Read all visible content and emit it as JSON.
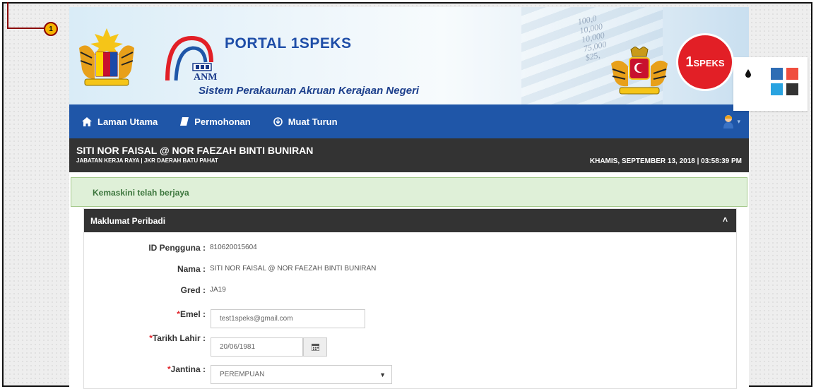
{
  "callout": {
    "number": "1"
  },
  "header": {
    "title": "PORTAL 1SPEKS",
    "subtitle": "Sistem Perakaunan Akruan Kerajaan Negeri",
    "anm_label": "ANM",
    "brand_logo": {
      "prefix": "1",
      "text": "SPEKS"
    },
    "numbers_deco": [
      "100,0",
      "10,000",
      "10,000",
      "75,000",
      "$25,"
    ]
  },
  "navbar": {
    "items": [
      {
        "label": "Laman Utama",
        "icon": "home-icon"
      },
      {
        "label": "Permohonan",
        "icon": "book-icon"
      },
      {
        "label": "Muat Turun",
        "icon": "download-circle-icon"
      }
    ],
    "avatar_icon": "user-avatar-icon",
    "caret": "▾"
  },
  "user": {
    "name": "SITI NOR FAISAL @ NOR FAEZAH BINTI BUNIRAN",
    "department": "JABATAN KERJA RAYA | JKR DAERAH BATU PAHAT",
    "datetime": "KHAMIS, SEPTEMBER 13, 2018 | 03:58:39 PM"
  },
  "alert": {
    "message": "Kemaskini telah berjaya"
  },
  "panel": {
    "title": "Maklumat Peribadi",
    "toggle": "˄",
    "fields": {
      "id": {
        "label": "ID Pengguna",
        "value": "810620015604"
      },
      "nama": {
        "label": "Nama",
        "value": "SITI NOR FAISAL @ NOR FAEZAH BINTI BUNIRAN"
      },
      "gred": {
        "label": "Gred",
        "value": "JA19"
      },
      "emel": {
        "label": "Emel",
        "required": "*",
        "value": "test1speks@gmail.com"
      },
      "tarikh": {
        "label": "Tarikh Lahir",
        "required": "*",
        "value": "20/06/1981"
      },
      "jantina": {
        "label": "Jantina",
        "required": "*",
        "value": "PEREMPUAN"
      }
    },
    "colon": ":"
  },
  "theme_picker": {
    "icon": "droplet-icon",
    "swatches": [
      "#2e6db4",
      "#f04e3e",
      "#29a3e0",
      "#333333"
    ]
  },
  "colors": {
    "navbar": "#1f56a8",
    "userbar": "#333333",
    "alert_bg": "#dff0d8",
    "alert_text": "#3c763d",
    "required": "#e0242b"
  }
}
